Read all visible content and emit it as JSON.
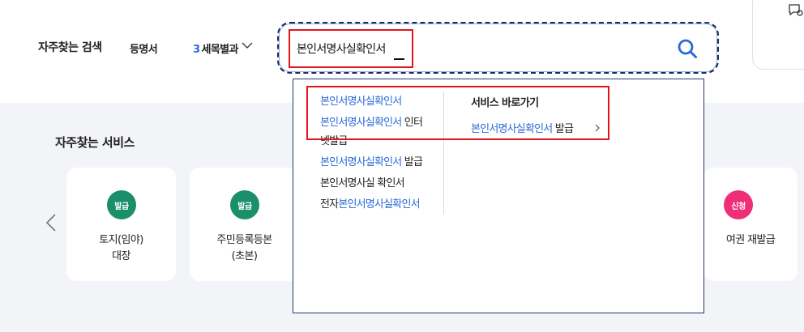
{
  "frequent_keywords": {
    "label": "자주찾는 검색",
    "items": [
      {
        "text": "등명서"
      },
      {
        "num": "3",
        "text": "세목별과"
      }
    ]
  },
  "search": {
    "value": "본인서명사실확인서",
    "placeholder": ""
  },
  "suggestions": {
    "items": [
      {
        "hit": "본인서명사실확인서",
        "rest": ""
      },
      {
        "hit": "본인서명사실확인서",
        "rest": " 인터"
      },
      {
        "hit": "",
        "rest": "넷발급"
      },
      {
        "hit": "본인서명사실확인서",
        "rest": " 발급"
      },
      {
        "hit": "",
        "rest": "본인서명사실 확인서"
      },
      {
        "pre": "전자",
        "hit": "본인서명사실확인서",
        "rest": ""
      }
    ],
    "service_shortcut": {
      "title": "서비스 바로가기",
      "link_hit": "본인서명사실확인서",
      "link_rest": " 발급"
    }
  },
  "frequent_services": {
    "title": "자주찾는 서비스",
    "cards": [
      {
        "badge": "발급",
        "badge_color": "#1a8f6a",
        "label": "토지(임야)\n대장"
      },
      {
        "badge": "발급",
        "badge_color": "#1a8f6a",
        "label": "주민등록등본\n(초본)"
      },
      {
        "badge": "신청",
        "badge_color": "#ee2f78",
        "label": "여권 재발급"
      }
    ]
  },
  "colors": {
    "accent": "#2a6ad8",
    "highlight_box": "#e4141c",
    "dropdown_border": "#1f3b6f"
  },
  "icons": [
    "search-icon",
    "chevron-down-icon",
    "chevron-left-icon",
    "chevron-right-icon",
    "chat-icon"
  ]
}
